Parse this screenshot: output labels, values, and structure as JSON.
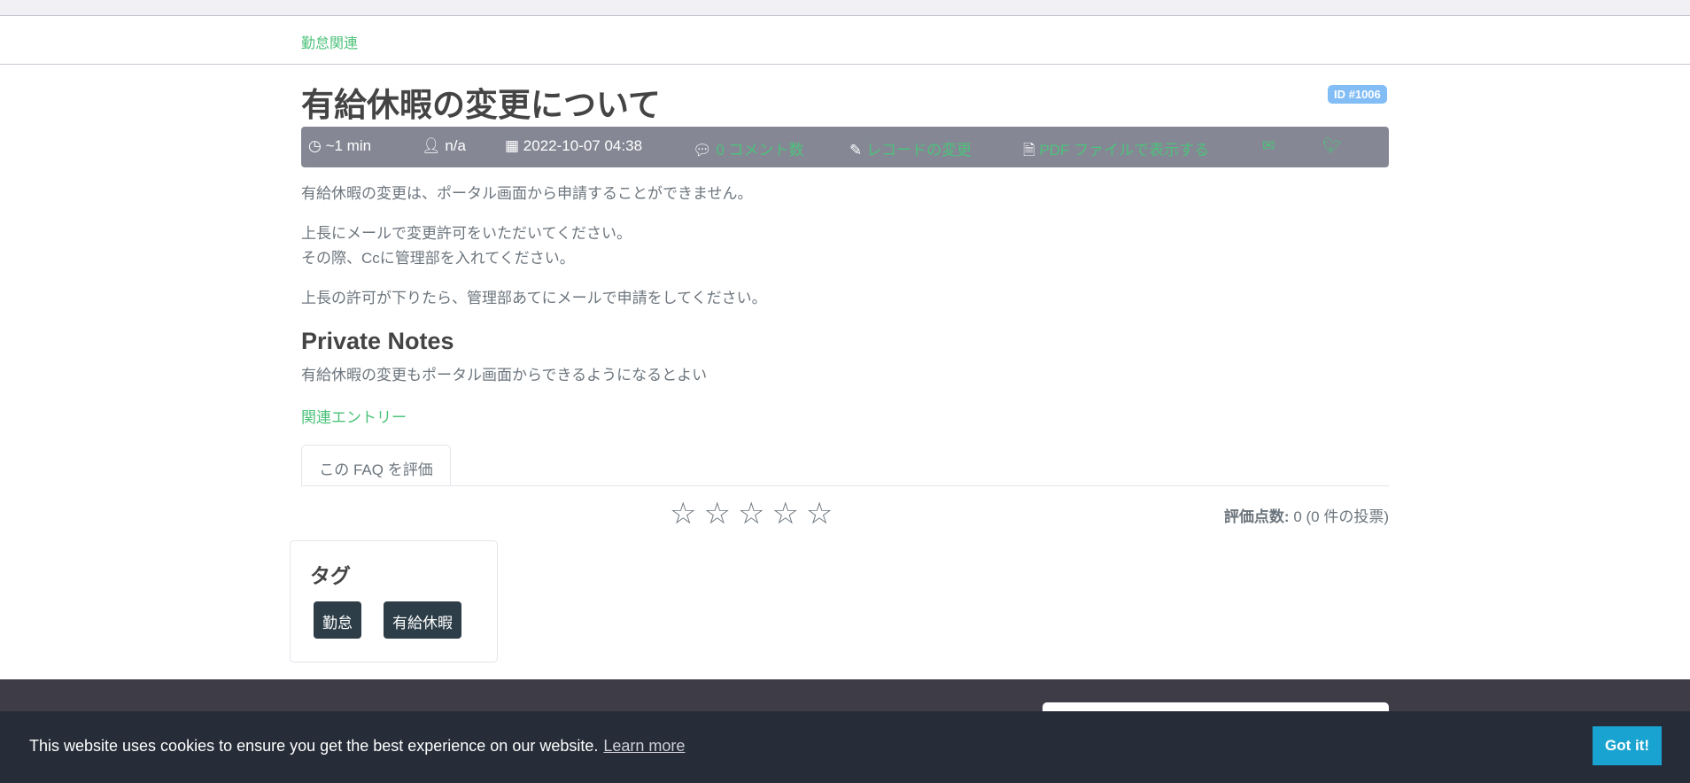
{
  "breadcrumb": "勤怠関連",
  "title": "有給休暇の変更について",
  "id_badge": "ID #1006",
  "meta": {
    "read_time": "~1 min",
    "author": "n/a",
    "date": "2022-10-07 04:38",
    "comments": "0 コメント数",
    "edit": "レコードの変更",
    "pdf": "PDF ファイルで表示する"
  },
  "body": [
    "有給休暇の変更は、ポータル画面から申請することができません。",
    "上長にメールで変更許可をいただいてください。",
    "その際、Ccに管理部を入れてください。",
    "上長の許可が下りたら、管理部あてにメールで申請をしてください。"
  ],
  "private_notes": {
    "heading": "Private Notes",
    "text": "有給休暇の変更もポータル画面からできるようになるとよい"
  },
  "related": "関連エントリー",
  "rating": {
    "tab": "この FAQ を評価",
    "stars": "☆☆☆☆☆",
    "label": "評価点数:",
    "value": " 0 (0 件の投票)",
    "score": 0,
    "max": 5
  },
  "tags": {
    "heading": "タグ",
    "items": [
      "勤怠",
      "有給休暇"
    ]
  },
  "cookie": {
    "message": "This website uses cookies to ensure you get the best experience on our website.",
    "learn_more": "Learn more",
    "button": "Got it!"
  },
  "colors": {
    "accent": "#4cc27a",
    "meta_bar": "#868795",
    "cookie_button": "#19a3d1"
  }
}
